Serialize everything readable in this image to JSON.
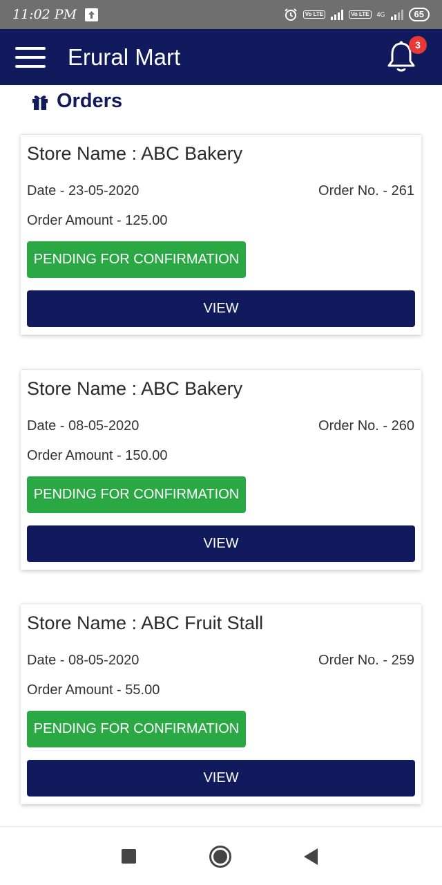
{
  "status_bar": {
    "time": "11:02 PM",
    "volte_label_1": "Vo LTE",
    "volte_label_2": "Vo LTE",
    "network_label": "4G",
    "battery": "65"
  },
  "app_bar": {
    "title": "Erural Mart",
    "notification_count": "3",
    "background_color": "#121a5e"
  },
  "page": {
    "title": "Orders",
    "title_icon": "gift-icon"
  },
  "orders": [
    {
      "store_name": "Store Name : ABC Bakery",
      "date": "Date - 23-05-2020",
      "order_no": "Order No. - 261",
      "amount": "Order Amount - 125.00",
      "status": "PENDING FOR CONFIRMATION",
      "action": "VIEW"
    },
    {
      "store_name": "Store Name : ABC Bakery",
      "date": "Date - 08-05-2020",
      "order_no": "Order No. - 260",
      "amount": "Order Amount - 150.00",
      "status": "PENDING FOR CONFIRMATION",
      "action": "VIEW"
    },
    {
      "store_name": "Store Name : ABC Fruit Stall",
      "date": "Date - 08-05-2020",
      "order_no": "Order No. - 259",
      "amount": "Order Amount - 55.00",
      "status": "PENDING FOR CONFIRMATION",
      "action": "VIEW"
    }
  ],
  "colors": {
    "status_pending": "#2aa844",
    "primary": "#121a5e"
  },
  "nav_bar": {
    "icons": [
      "recents-icon",
      "home-icon",
      "back-icon"
    ]
  }
}
